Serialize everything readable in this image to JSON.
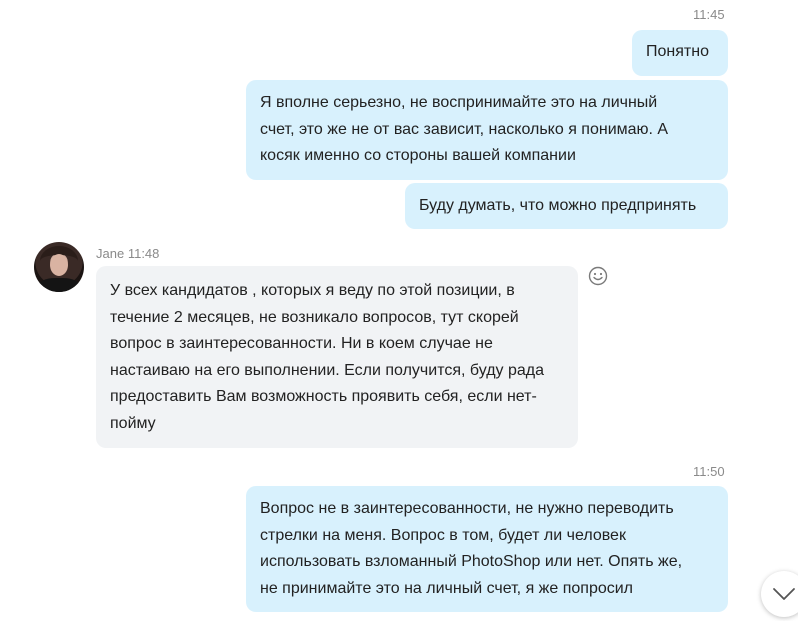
{
  "messages": [
    {
      "kind": "timestamp",
      "text": "11:45"
    },
    {
      "kind": "outgoing",
      "text": "Понятно"
    },
    {
      "kind": "outgoing",
      "text": "Я вполне серьезно, не воспринимайте это на личный\nсчет, это же не от вас зависит, насколько я понимаю. А\nкосяк именно со стороны вашей компании"
    },
    {
      "kind": "outgoing",
      "text": "Буду думать, что можно предпринять"
    },
    {
      "kind": "incoming",
      "sender": "Jane",
      "time": "11:48",
      "text": "У всех кандидатов , которых я веду по этой позиции, в\nтечение 2 месяцев, не возникало вопросов, тут скорей\nвопрос в заинтересованности. Ни в коем случае не\nнастаиваю на его выполнении. Если получится, буду рада\nпредоставить Вам возможность проявить себя, если нет-\nпойму"
    },
    {
      "kind": "timestamp",
      "text": "11:50"
    },
    {
      "kind": "outgoing",
      "text": "Вопрос не в заинтересованности, не нужно переводить\nстрелки на меня. Вопрос в том, будет ли человек\nиспользовать взломанный PhotoShop или нет. Опять же,\nне принимайте это на личный счет, я же попросил"
    }
  ],
  "icons": {
    "emoji": "smiley-icon",
    "scroll": "chevron-down-icon",
    "avatar": "avatar"
  },
  "colors": {
    "outgoing_bubble": "#d8f1fd",
    "incoming_bubble": "#f1f3f5",
    "timestamp": "#8a8a8a"
  }
}
